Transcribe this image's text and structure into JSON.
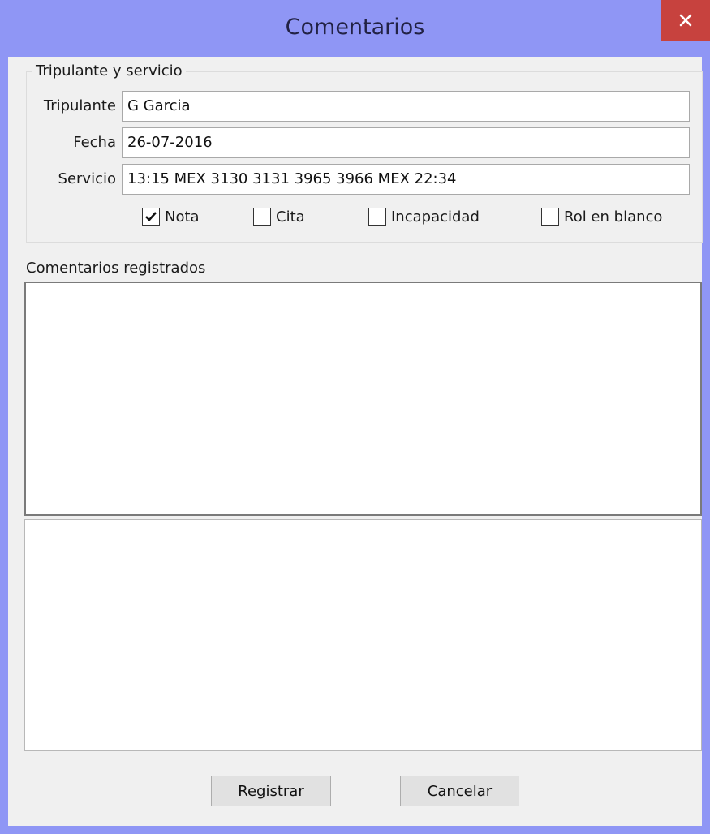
{
  "window": {
    "title": "Comentarios",
    "close_glyph": "✕"
  },
  "crew_group": {
    "title": "Tripulante y servicio",
    "fields": {
      "tripulante": {
        "label": "Tripulante",
        "value": "G Garcia"
      },
      "fecha": {
        "label": "Fecha",
        "value": "26-07-2016"
      },
      "servicio": {
        "label": "Servicio",
        "value": "13:15 MEX 3130 3131 3965 3966 MEX 22:34"
      }
    },
    "checkboxes": {
      "nota": {
        "label": "Nota",
        "checked": true
      },
      "cita": {
        "label": "Cita",
        "checked": false
      },
      "incapacidad": {
        "label": "Incapacidad",
        "checked": false
      },
      "rol_en_blanco": {
        "label": "Rol en blanco",
        "checked": false
      }
    }
  },
  "comments": {
    "section_label": "Comentarios registrados",
    "registered_text": "",
    "new_text": ""
  },
  "buttons": {
    "register": "Registrar",
    "cancel": "Cancelar"
  },
  "colors": {
    "titlebar": "#8f96f5",
    "close_button": "#c7423e",
    "client_bg": "#f0f0f0"
  }
}
